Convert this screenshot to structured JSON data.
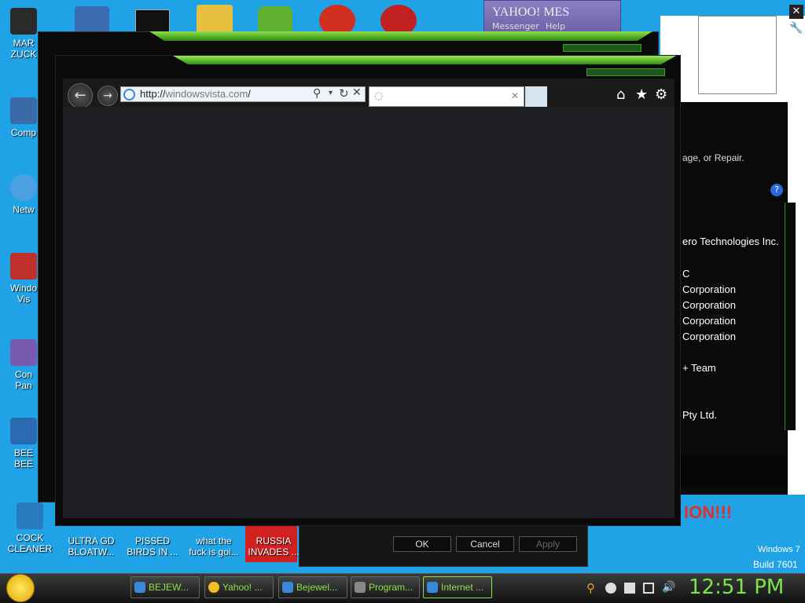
{
  "desktop_icons": [
    {
      "label": "MAR\nZUCK",
      "color": "#2a2a2a"
    },
    {
      "label": "Comp",
      "color": "#3a6aa8"
    },
    {
      "label": "Netw",
      "color": "#4aa0e0"
    },
    {
      "label": "Windo\nVis",
      "color": "#c0302a"
    },
    {
      "label": "Con\nPan",
      "color": "#7a5ab0"
    },
    {
      "label": "BEE\nBEE",
      "color": "#2a6ab0"
    },
    {
      "label": "COCK\nCLEANER",
      "color": "#2a7ac0"
    },
    {
      "label": "ULTRA GD\nBLOATW...",
      "color": "#3a3a3a"
    },
    {
      "label": "PISSED\nBIRDS IN ...",
      "color": "#3aa040"
    },
    {
      "label": "what the\nfuck is goi...",
      "color": "#3a88d8"
    },
    {
      "label": "RUSSIA\nINVADES ...",
      "color": "#d02020"
    }
  ],
  "top_icons": [
    {
      "color": "#3a6ab0"
    },
    {
      "color": "#111111"
    },
    {
      "color": "#e8c040"
    },
    {
      "color": "#60b030"
    },
    {
      "color": "#d03020"
    },
    {
      "color": "#c02020"
    }
  ],
  "yahoo": {
    "title": "YAHOO! MES",
    "menu1": "Messenger",
    "menu2": "Help"
  },
  "right_app": {
    "line1": "age, or Repair.",
    "vendor1": "ero Technologies Inc.",
    "vendor2": "C",
    "vendor3": "Corporation",
    "vendor4": "Corporation",
    "vendor5": "Corporation",
    "vendor6": "Corporation",
    "vendor7": "+ Team",
    "vendor8": "Pty Ltd.",
    "banner": "ION!!!"
  },
  "dialog": {
    "ok": "OK",
    "cancel": "Cancel",
    "apply": "Apply"
  },
  "browser": {
    "url_prefix": "http://",
    "url_domain": "windowsvista.com",
    "url_suffix": "/",
    "tab_icon": "loading-icon"
  },
  "watermark": {
    "line1": "Windows 7",
    "line2": "Build 7601"
  },
  "taskbar": {
    "items": [
      {
        "label": "BEJEW...",
        "color": "#3a88d8"
      },
      {
        "label": "Yahoo! ...",
        "color": "#f0c020"
      },
      {
        "label": "Bejewel...",
        "color": "#3a88d8"
      },
      {
        "label": "Program...",
        "color": "#888888"
      },
      {
        "label": "Internet ...",
        "color": "#3a88d8"
      }
    ],
    "clock": "12:51 PM"
  }
}
